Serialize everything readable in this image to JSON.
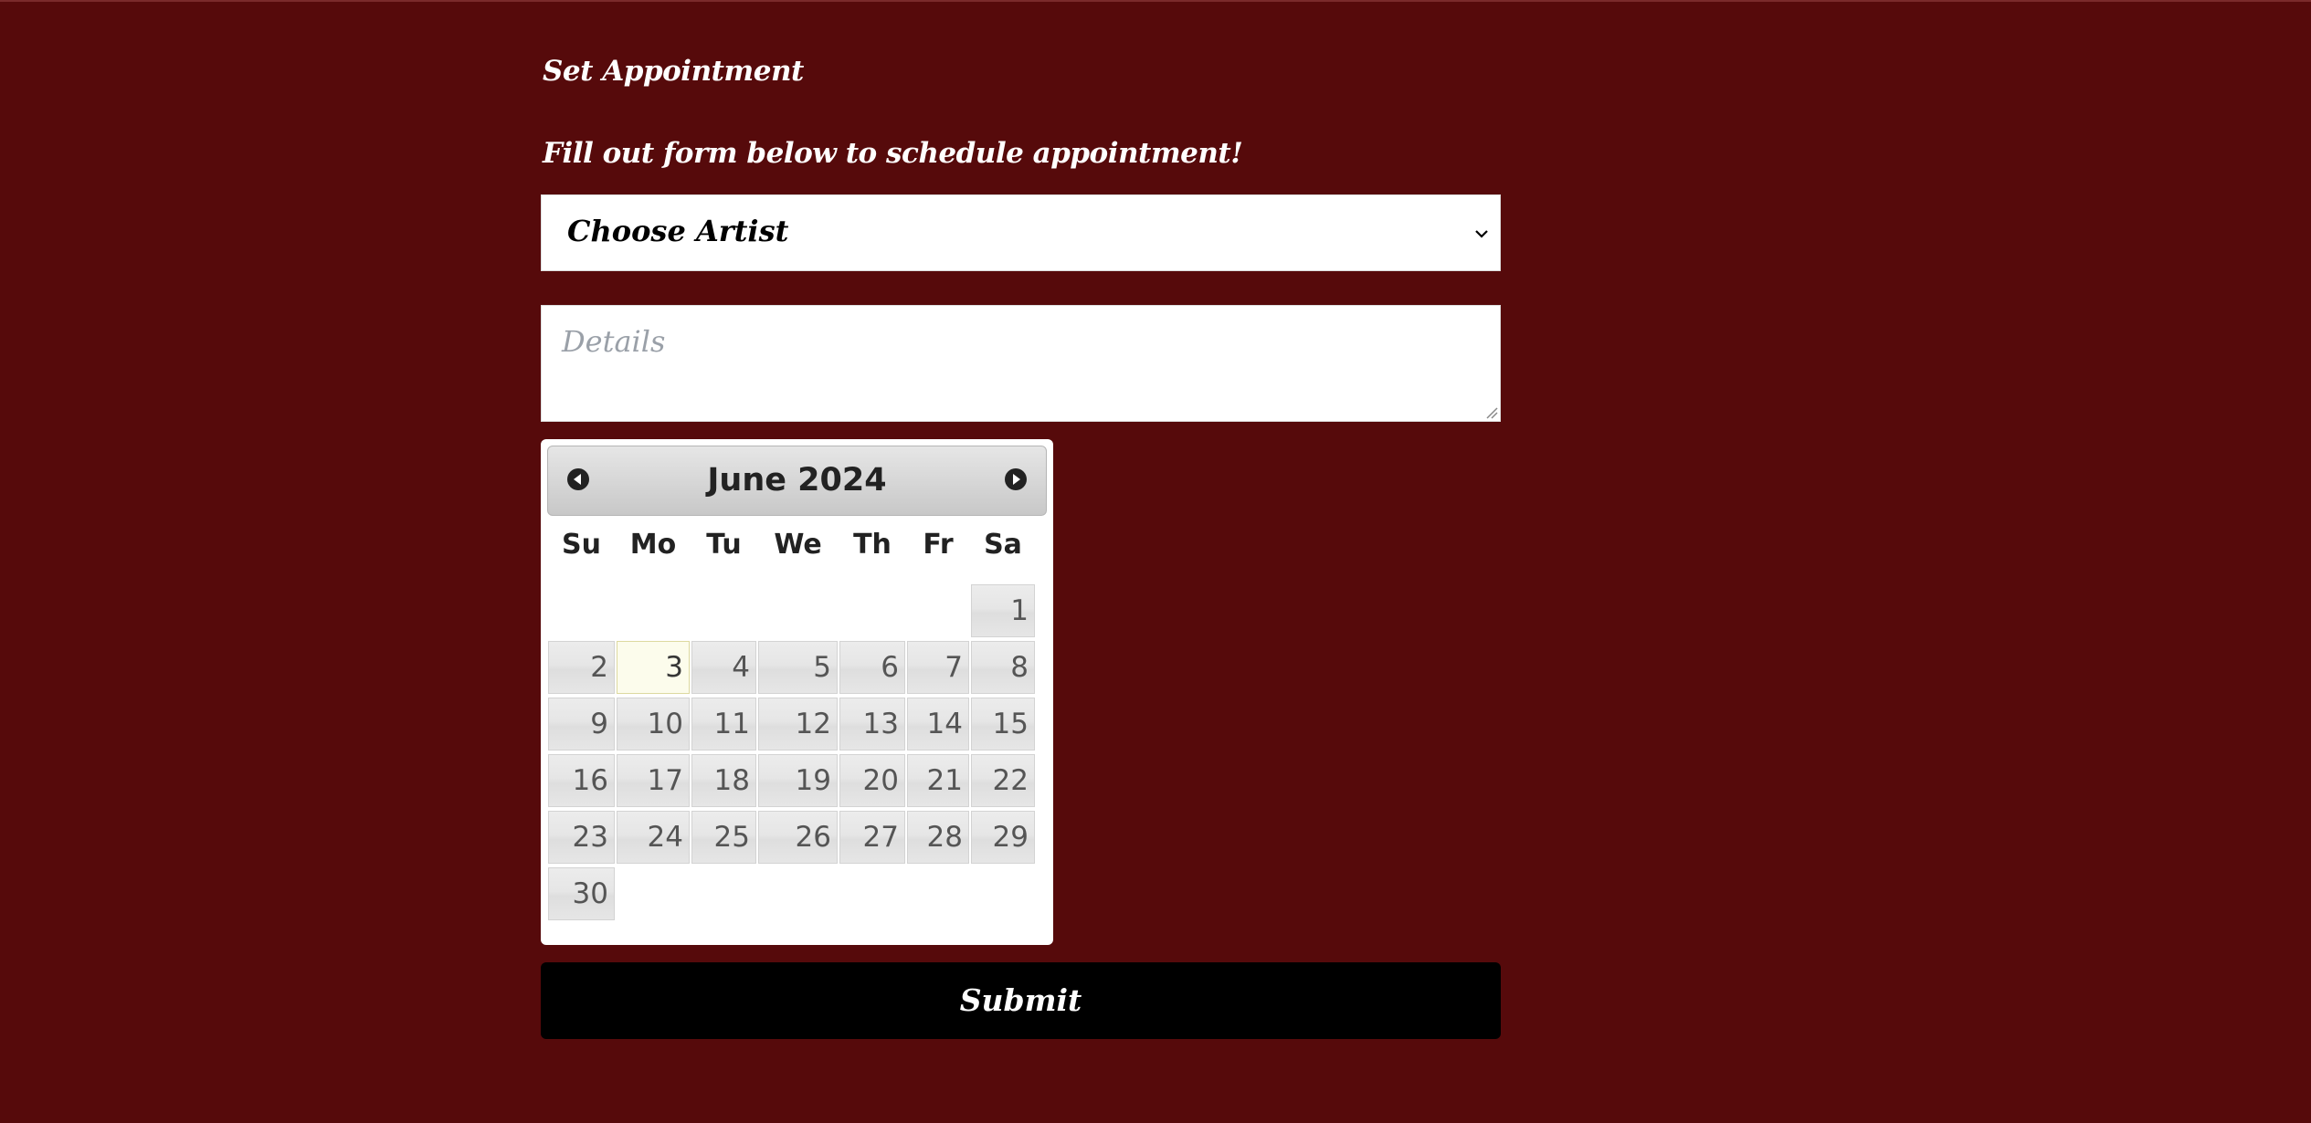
{
  "header": {
    "title": "Set Appointment",
    "subtitle": "Fill out form below to schedule appointment!"
  },
  "form": {
    "artist_select": {
      "selected": "Choose Artist",
      "icon": "chevron-down-icon"
    },
    "details": {
      "placeholder": "Details"
    },
    "submit_label": "Submit"
  },
  "datepicker": {
    "month_year": "June 2024",
    "prev_icon": "prev-month-icon",
    "next_icon": "next-month-icon",
    "weekdays": [
      "Su",
      "Mo",
      "Tu",
      "We",
      "Th",
      "Fr",
      "Sa"
    ],
    "weeks": [
      [
        "",
        "",
        "",
        "",
        "",
        "",
        "1"
      ],
      [
        "2",
        "3",
        "4",
        "5",
        "6",
        "7",
        "8"
      ],
      [
        "9",
        "10",
        "11",
        "12",
        "13",
        "14",
        "15"
      ],
      [
        "16",
        "17",
        "18",
        "19",
        "20",
        "21",
        "22"
      ],
      [
        "23",
        "24",
        "25",
        "26",
        "27",
        "28",
        "29"
      ],
      [
        "30",
        "",
        "",
        "",
        "",
        "",
        ""
      ]
    ],
    "highlighted_day": "3"
  },
  "colors": {
    "background": "#560a0b",
    "submit": "#000000",
    "today_highlight": "#fcfcec"
  }
}
